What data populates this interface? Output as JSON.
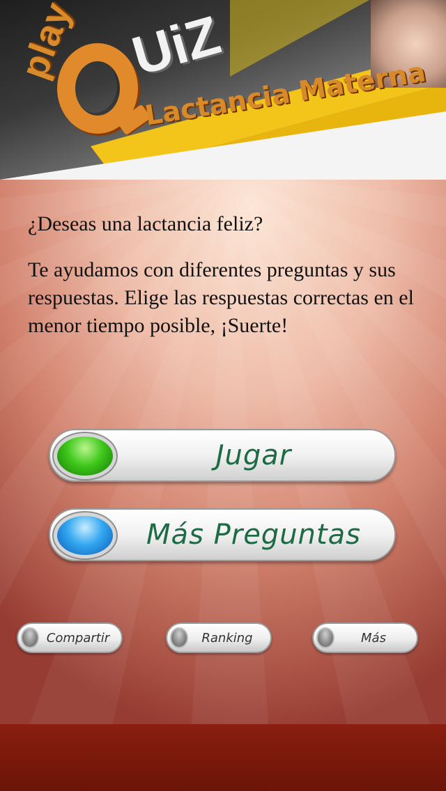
{
  "header": {
    "logo_play": "play",
    "logo_uiz": "UiZ",
    "title": "Lactancia Materna",
    "photo_icon": "baby-photo"
  },
  "intro": {
    "question": "¿Deseas una lactancia feliz?",
    "description": "Te ayudamos con diferentes preguntas y sus respuestas. Elige las respuestas correctas en el menor tiempo posible, ¡Suerte!"
  },
  "buttons": {
    "play": {
      "label": "Jugar",
      "orb_color": "#3fc81b"
    },
    "more_questions": {
      "label": "Más Preguntas",
      "orb_color": "#33a8f0"
    }
  },
  "small_buttons": [
    {
      "label": "Compartir"
    },
    {
      "label": "Ranking"
    },
    {
      "label": "Más"
    }
  ],
  "colors": {
    "brand_orange": "#e08a2b",
    "button_text": "#1d6b45",
    "footer": "#7a1a0c"
  }
}
